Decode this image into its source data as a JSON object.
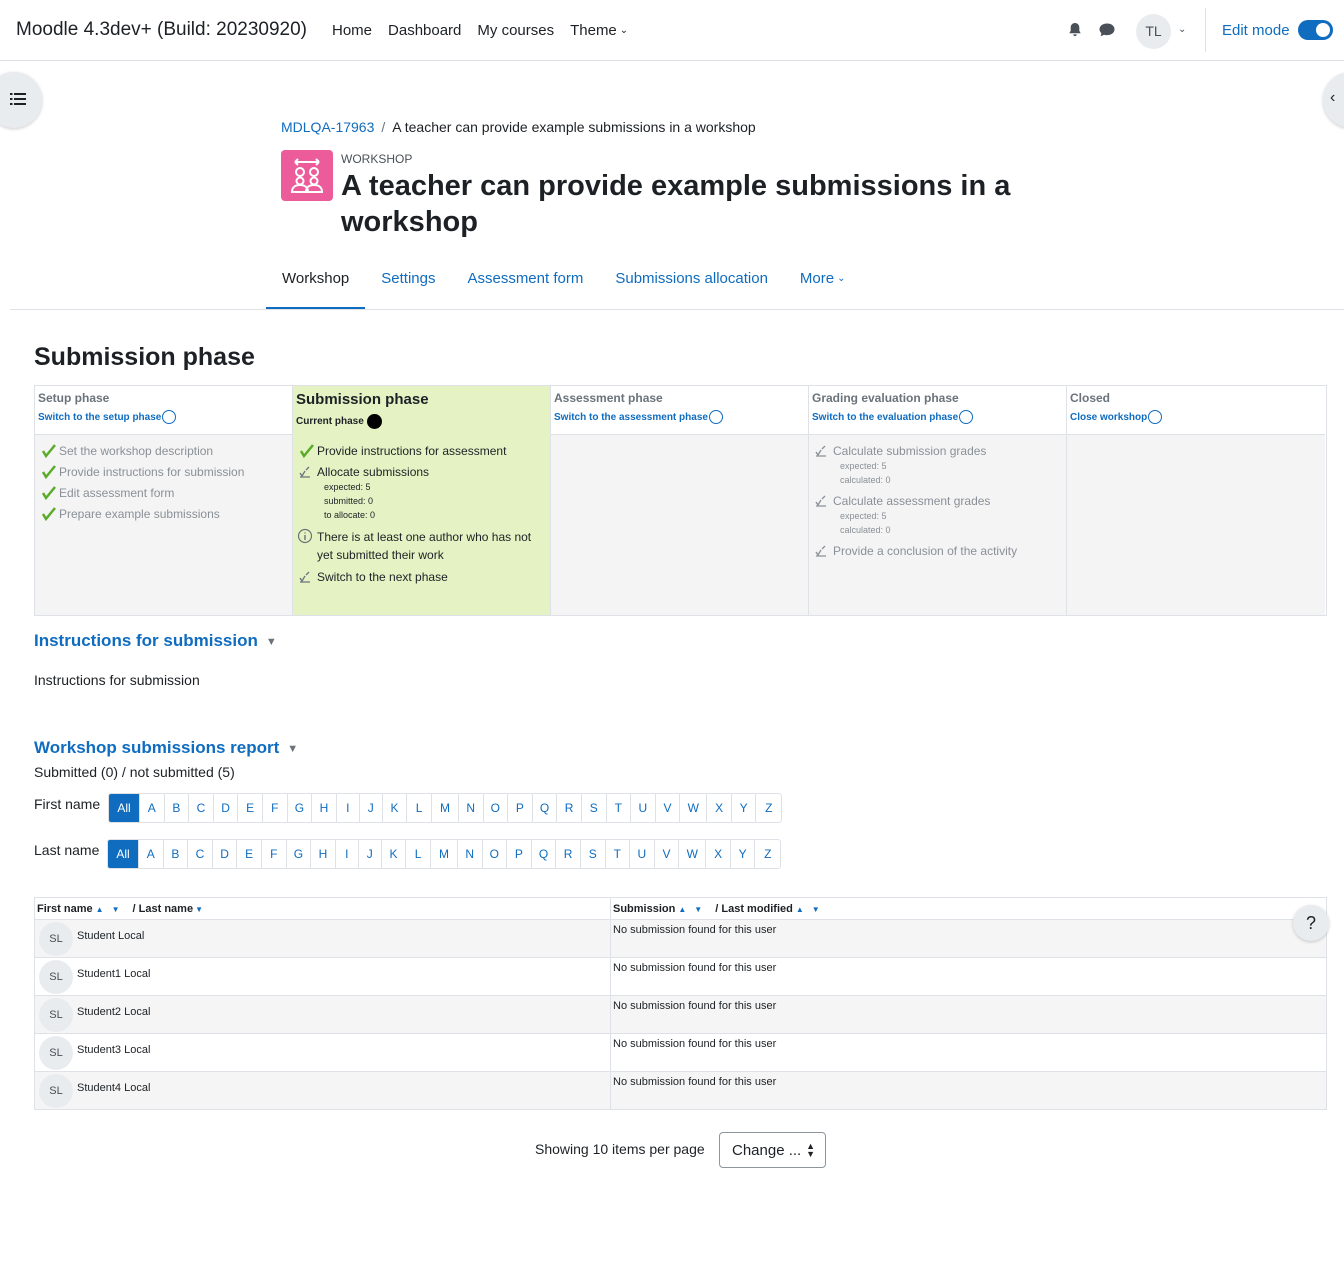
{
  "navbar": {
    "brand": "Moodle 4.3dev+ (Build: 20230920)",
    "links": [
      "Home",
      "Dashboard",
      "My courses",
      "Theme"
    ],
    "user_initials": "TL",
    "edit_mode_label": "Edit mode",
    "edit_mode_on": true
  },
  "breadcrumb": {
    "course": "MDLQA-17963",
    "current": "A teacher can provide example submissions in a workshop"
  },
  "header": {
    "activity_type": "WORKSHOP",
    "title": "A teacher can provide example submissions in a workshop",
    "icon_color": "#ec5c9a"
  },
  "secondary_nav": {
    "tabs": [
      "Workshop",
      "Settings",
      "Assessment form",
      "Submissions allocation",
      "More"
    ],
    "active": "Workshop"
  },
  "phase_heading": "Submission phase",
  "userplan": {
    "phases": [
      {
        "title": "Setup phase",
        "link": "Switch to the setup phase",
        "tasks": [
          {
            "label": "Set the workshop description",
            "status": "done"
          },
          {
            "label": "Provide instructions for submission",
            "status": "done"
          },
          {
            "label": "Edit assessment form",
            "status": "done"
          },
          {
            "label": "Prepare example submissions",
            "status": "done"
          }
        ]
      },
      {
        "title": "Submission phase",
        "current_label": "Current phase",
        "tasks": [
          {
            "label": "Provide instructions for assessment",
            "status": "done"
          },
          {
            "label": "Allocate submissions",
            "status": "todo",
            "details": [
              "expected: 5",
              "submitted: 0",
              "to allocate: 0"
            ]
          },
          {
            "label": "There is at least one author who has not yet submitted their work",
            "status": "info"
          },
          {
            "label": "Switch to the next phase",
            "status": "todo"
          }
        ]
      },
      {
        "title": "Assessment phase",
        "link": "Switch to the assessment phase",
        "tasks": []
      },
      {
        "title": "Grading evaluation phase",
        "link": "Switch to the evaluation phase",
        "tasks": [
          {
            "label": "Calculate submission grades",
            "status": "todo",
            "details": [
              "expected: 5",
              "calculated: 0"
            ]
          },
          {
            "label": "Calculate assessment grades",
            "status": "todo",
            "details": [
              "expected: 5",
              "calculated: 0"
            ]
          },
          {
            "label": "Provide a conclusion of the activity",
            "status": "todo"
          }
        ]
      },
      {
        "title": "Closed",
        "link": "Close workshop",
        "tasks": []
      }
    ]
  },
  "instructions": {
    "heading": "Instructions for submission",
    "text": "Instructions for submission"
  },
  "report": {
    "heading": "Workshop submissions report",
    "summary": "Submitted (0) / not submitted (5)",
    "firstname_label": "First name",
    "lastname_label": "Last name",
    "all_label": "All",
    "letters": [
      "A",
      "B",
      "C",
      "D",
      "E",
      "F",
      "G",
      "H",
      "I",
      "J",
      "K",
      "L",
      "M",
      "N",
      "O",
      "P",
      "Q",
      "R",
      "S",
      "T",
      "U",
      "V",
      "W",
      "X",
      "Y",
      "Z"
    ],
    "columns": {
      "first_name": "First name",
      "last_name": "/ Last name",
      "submission": "Submission",
      "last_modified": "/ Last modified"
    },
    "rows": [
      {
        "initials": "SL",
        "name": "Student Local",
        "submission": "No submission found for this user"
      },
      {
        "initials": "SL",
        "name": "Student1 Local",
        "submission": "No submission found for this user"
      },
      {
        "initials": "SL",
        "name": "Student2 Local",
        "submission": "No submission found for this user"
      },
      {
        "initials": "SL",
        "name": "Student3 Local",
        "submission": "No submission found for this user"
      },
      {
        "initials": "SL",
        "name": "Student4 Local",
        "submission": "No submission found for this user"
      }
    ],
    "per_page_label": "Showing 10 items per page",
    "per_page_select": "Change ..."
  },
  "help_label": "?",
  "colors": {
    "primary": "#0f6cbf",
    "active_phase_bg": "#e5f2c4",
    "done_check": "#5bab2b"
  }
}
